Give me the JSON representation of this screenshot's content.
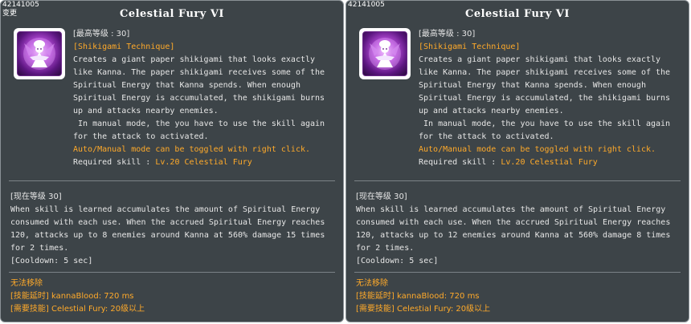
{
  "panels": [
    {
      "skill_id": "42141005",
      "tag": "变更",
      "title": "Celestial Fury VI",
      "icon": "paper-shikigami-icon",
      "max_level": "[最高等级 : 30]",
      "category": "[Shikigami Technique]",
      "description": [
        "Creates a giant paper shikigami that looks exactly",
        "like Kanna. The paper shikigami receives some of the",
        "Spiritual Energy that Kanna spends. When enough",
        "Spiritual Energy is accumulated, the shikigami burns",
        "up and attacks nearby enemies.",
        " In manual mode, the you have to use the skill again",
        "for the attack to activated."
      ],
      "toggle_note": "Auto/Manual mode can be toggled with right click.",
      "required_label": "Required skill : ",
      "required_value": "Lv.20 Celestial Fury",
      "current_level": "[现在等级 30]",
      "effect": [
        "When skill is learned accumulates the amount of Spiritual Energy",
        "consumed with each use. When the accrued Spiritual Energy reaches",
        "120, attacks up to 8 enemies around Kanna at 560% damage 15 times",
        "for 2 times."
      ],
      "cooldown": "[Cooldown: 5 sec]",
      "notes": [
        "无法移除",
        "[技能延时] kannaBlood: 720 ms",
        "[需要技能] Celestial Fury: 20级以上"
      ]
    },
    {
      "skill_id": "42141005",
      "tag": "",
      "title": "Celestial Fury VI",
      "icon": "paper-shikigami-icon",
      "max_level": "[最高等级 : 30]",
      "category": "[Shikigami Technique]",
      "description": [
        "Creates a giant paper shikigami that looks exactly",
        "like Kanna. The paper shikigami receives some of the",
        "Spiritual Energy that Kanna spends. When enough",
        "Spiritual Energy is accumulated, the shikigami burns",
        "up and attacks nearby enemies.",
        " In manual mode, the you have to use the skill again",
        "for the attack to activated."
      ],
      "toggle_note": "Auto/Manual mode can be toggled with right click.",
      "required_label": "Required skill : ",
      "required_value": "Lv.20 Celestial Fury",
      "current_level": "[现在等级 30]",
      "effect": [
        "When skill is learned accumulates the amount of Spiritual Energy",
        "consumed with each use. When the accrued Spiritual Energy reaches",
        "120, attacks up to 12 enemies around Kanna at 560% damage 8 times",
        "for 2 times."
      ],
      "cooldown": "[Cooldown: 5 sec]",
      "notes": [
        "无法移除",
        "[技能延时] kannaBlood: 720 ms",
        "[需要技能] Celestial Fury: 20级以上"
      ]
    }
  ],
  "colors": {
    "panel_bg": "#3d4448",
    "text": "#e6e6e6",
    "highlight": "#ffaa2a",
    "divider": "#7b8287"
  }
}
